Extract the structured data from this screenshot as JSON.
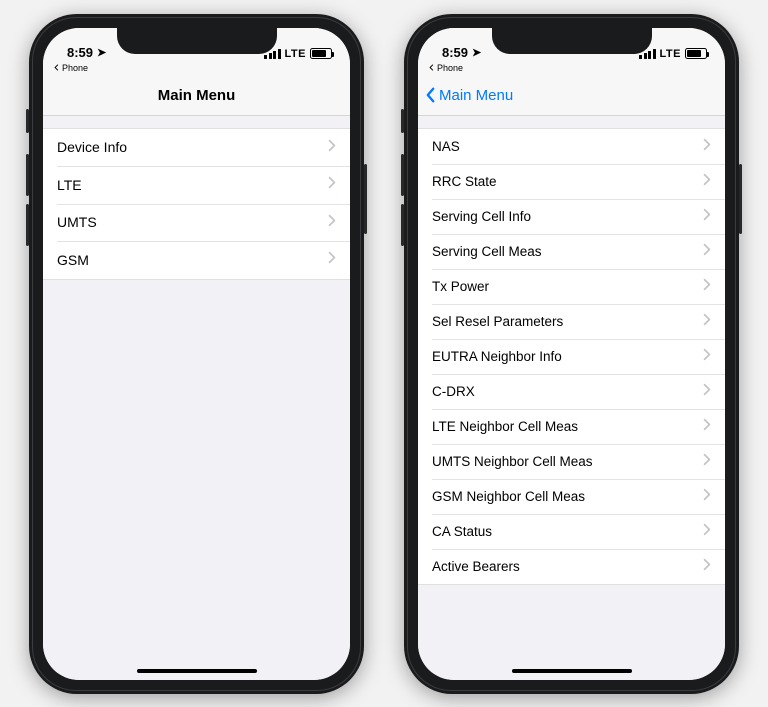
{
  "status": {
    "time": "8:59",
    "network_label": "LTE",
    "back_to_app": "Phone"
  },
  "phone_left": {
    "nav_title": "Main Menu",
    "list": [
      {
        "label": "Device Info"
      },
      {
        "label": "LTE"
      },
      {
        "label": "UMTS"
      },
      {
        "label": "GSM"
      }
    ]
  },
  "phone_right": {
    "nav_back_label": "Main Menu",
    "list": [
      {
        "label": "NAS"
      },
      {
        "label": "RRC State"
      },
      {
        "label": "Serving Cell Info"
      },
      {
        "label": "Serving Cell Meas"
      },
      {
        "label": "Tx Power"
      },
      {
        "label": "Sel Resel Parameters"
      },
      {
        "label": "EUTRA Neighbor Info"
      },
      {
        "label": "C-DRX"
      },
      {
        "label": "LTE Neighbor Cell Meas"
      },
      {
        "label": "UMTS Neighbor Cell Meas"
      },
      {
        "label": "GSM Neighbor Cell Meas"
      },
      {
        "label": "CA Status"
      },
      {
        "label": "Active Bearers"
      }
    ]
  }
}
